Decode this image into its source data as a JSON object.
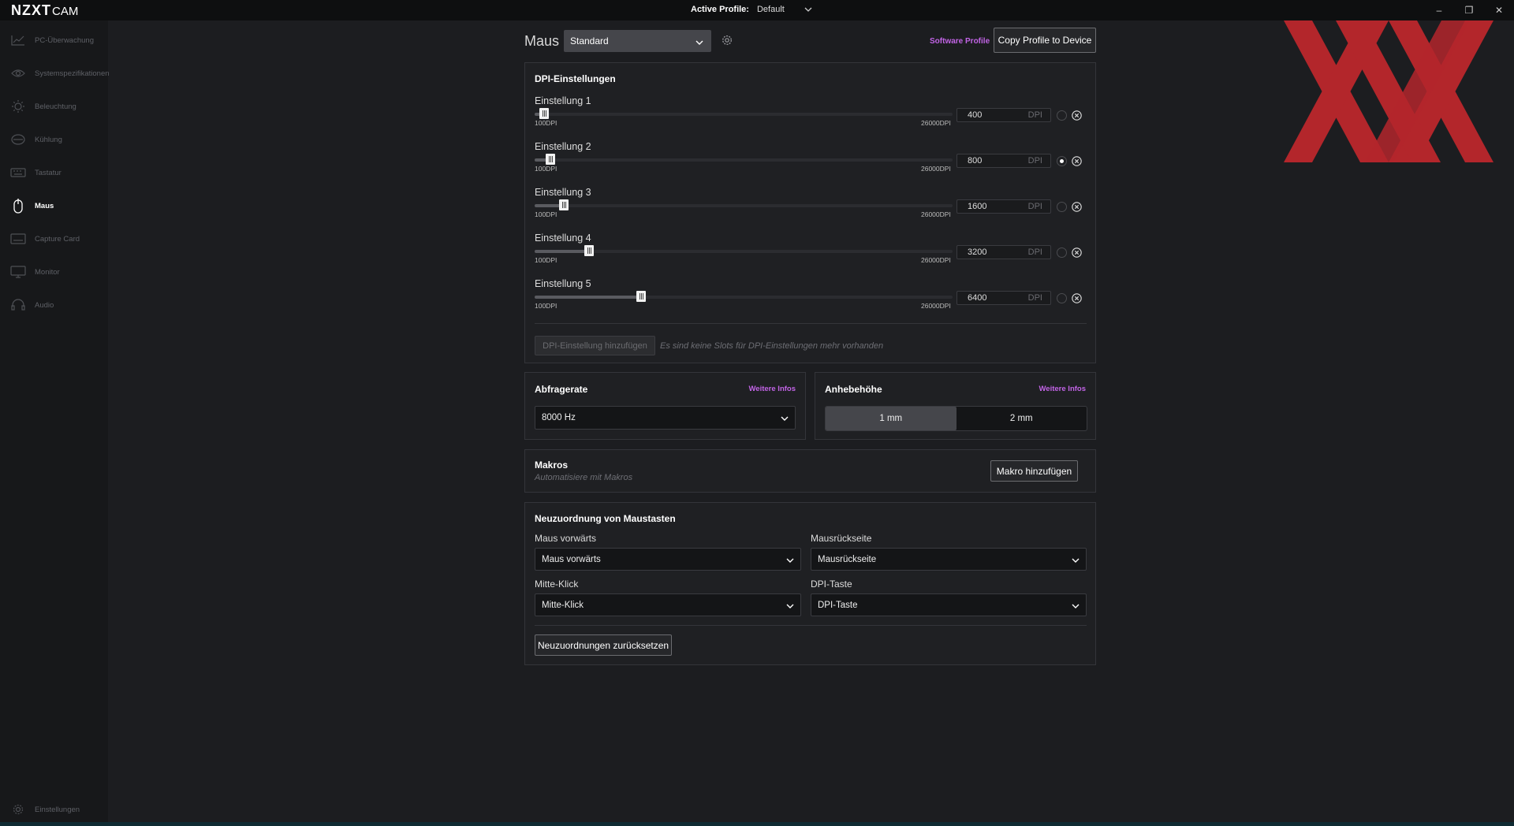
{
  "app": {
    "brand_bold": "NZXT",
    "brand_light": "CAM"
  },
  "titlebar": {
    "active_profile_label": "Active Profile:",
    "active_profile_value": "Default",
    "minimize": "–",
    "restore": "❐",
    "close": "✕"
  },
  "sidebar": {
    "items": [
      {
        "label": "PC-Überwachung",
        "icon": "chart-line-icon"
      },
      {
        "label": "Systemspezifikationen",
        "icon": "eye-icon"
      },
      {
        "label": "Beleuchtung",
        "icon": "sun-icon"
      },
      {
        "label": "Kühlung",
        "icon": "cooler-icon"
      },
      {
        "label": "Tastatur",
        "icon": "keyboard-icon"
      },
      {
        "label": "Maus",
        "icon": "mouse-icon",
        "active": true
      },
      {
        "label": "Capture Card",
        "icon": "capture-card-icon"
      },
      {
        "label": "Monitor",
        "icon": "monitor-icon"
      },
      {
        "label": "Audio",
        "icon": "headset-icon"
      }
    ],
    "settings_label": "Einstellungen"
  },
  "header": {
    "title": "Maus",
    "profile_value": "Standard",
    "software_profile": "Software Profile",
    "copy_button": "Copy Profile to Device"
  },
  "dpi": {
    "title": "DPI-Einstellungen",
    "min_label": "100DPI",
    "max_label": "26000DPI",
    "unit": "DPI",
    "min": 100,
    "max": 26000,
    "settings": [
      {
        "label": "Einstellung 1",
        "value": "400",
        "active": false
      },
      {
        "label": "Einstellung 2",
        "value": "800",
        "active": true
      },
      {
        "label": "Einstellung 3",
        "value": "1600",
        "active": false
      },
      {
        "label": "Einstellung 4",
        "value": "3200",
        "active": false
      },
      {
        "label": "Einstellung 5",
        "value": "6400",
        "active": false
      }
    ],
    "add_button": "DPI-Einstellung hinzufügen",
    "no_slots_text": "Es sind keine Slots für DPI-Einstellungen mehr vorhanden"
  },
  "polling": {
    "title": "Abfragerate",
    "more": "Weitere Infos",
    "value": "8000 Hz"
  },
  "lift": {
    "title": "Anhebehöhe",
    "more": "Weitere Infos",
    "options": [
      "1 mm",
      "2 mm"
    ],
    "selected": "1 mm"
  },
  "macros": {
    "title": "Makros",
    "subtitle": "Automatisiere mit Makros",
    "add_button": "Makro hinzufügen"
  },
  "remap": {
    "title": "Neuzuordnung von Maustasten",
    "fields": [
      {
        "label": "Maus vorwärts",
        "value": "Maus vorwärts"
      },
      {
        "label": "Mausrückseite",
        "value": "Mausrückseite"
      },
      {
        "label": "Mitte-Klick",
        "value": "Mitte-Klick"
      },
      {
        "label": "DPI-Taste",
        "value": "DPI-Taste"
      }
    ],
    "reset_button": "Neuzuordnungen zurücksetzen"
  },
  "colors": {
    "accent": "#c264e6",
    "background": "#1c1d20",
    "sidebar": "#17181a",
    "watermark_red": "#c0272d"
  }
}
